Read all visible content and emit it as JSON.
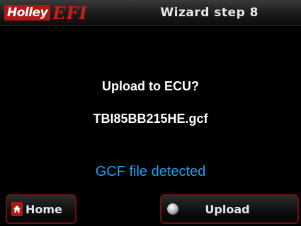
{
  "header": {
    "logo_holley": "Holley",
    "logo_efi": "EFI",
    "title": "Wizard step 8"
  },
  "main": {
    "prompt": "Upload to ECU?",
    "filename": "TBI85BB215HE.gcf",
    "status": "GCF file detected"
  },
  "buttons": {
    "home_label": "Home",
    "upload_label": "Upload"
  },
  "colors": {
    "accent_red": "#b01818",
    "status_blue": "#1aa0f0",
    "background": "#000000"
  },
  "icons": {
    "home": "home-icon",
    "upload": "upload-icon"
  }
}
